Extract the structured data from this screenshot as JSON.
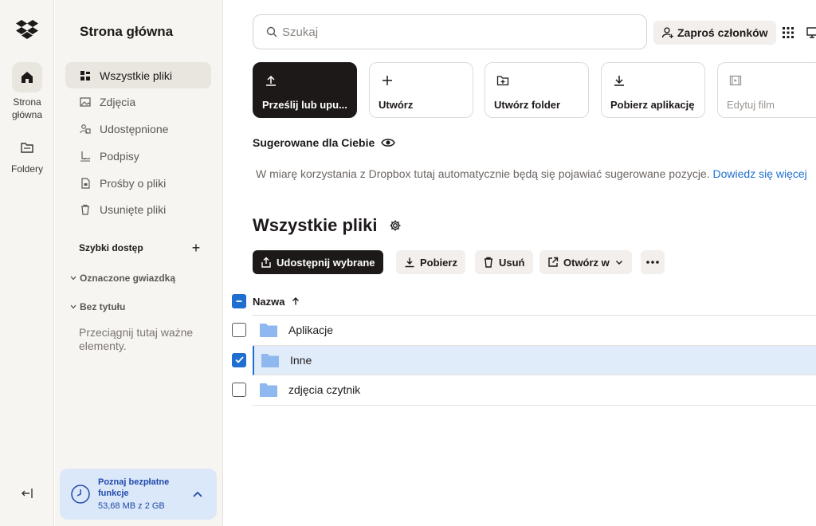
{
  "rail": {
    "home_label": "Strona główna",
    "folders_label": "Foldery"
  },
  "sidebar": {
    "title": "Strona główna",
    "items": [
      {
        "label": "Wszystkie pliki",
        "icon": "all-files-icon",
        "active": true
      },
      {
        "label": "Zdjęcia",
        "icon": "photo-icon",
        "active": false
      },
      {
        "label": "Udostępnione",
        "icon": "shared-icon",
        "active": false
      },
      {
        "label": "Podpisy",
        "icon": "signature-icon",
        "active": false
      },
      {
        "label": "Prośby o pliki",
        "icon": "file-request-icon",
        "active": false
      },
      {
        "label": "Usunięte pliki",
        "icon": "trash-icon",
        "active": false
      }
    ],
    "quick_access": "Szybki dostęp",
    "starred": "Oznaczone gwiazdką",
    "untitled": "Bez tytułu",
    "drag_hint": "Przeciągnij tutaj ważne elementy."
  },
  "promo": {
    "title": "Poznaj bezpłatne funkcje",
    "storage": "53,68 MB z 2 GB"
  },
  "header": {
    "search_placeholder": "Szukaj",
    "invite_label": "Zaproś członków"
  },
  "actions": [
    {
      "label": "Prześlij lub upu...",
      "icon": "upload-icon"
    },
    {
      "label": "Utwórz",
      "icon": "plus-icon"
    },
    {
      "label": "Utwórz folder",
      "icon": "new-folder-icon"
    },
    {
      "label": "Pobierz aplikację",
      "icon": "download-icon"
    },
    {
      "label": "Edytuj film",
      "icon": "film-icon"
    }
  ],
  "suggested": {
    "title": "Sugerowane dla Ciebie",
    "text": "W miarę korzystania z Dropbox tutaj automatycznie będą się pojawiać sugerowane pozycje.",
    "link": "Dowiedz się więcej"
  },
  "files": {
    "title": "Wszystkie pliki",
    "toolbar": {
      "share": "Udostępnij wybrane",
      "download": "Pobierz",
      "delete": "Usuń",
      "open_in": "Otwórz w"
    },
    "column_name": "Nazwa",
    "rows": [
      {
        "name": "Aplikacje",
        "selected": false
      },
      {
        "name": "Inne",
        "selected": true
      },
      {
        "name": "zdjęcia czytnik",
        "selected": false
      }
    ]
  },
  "colors": {
    "accent": "#1f6fd0",
    "primary_button": "#1e1919",
    "sidebar_bg": "#f7f5f2",
    "selected_row": "#e1ecfb",
    "folder": "#8fb8f0"
  }
}
